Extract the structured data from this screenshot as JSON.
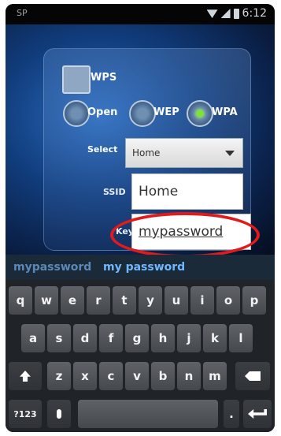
{
  "statusbar": {
    "left_label": "SP",
    "time": "6:12"
  },
  "form": {
    "wps_label": "WPS",
    "security": {
      "open_label": "Open",
      "wep_label": "WEP",
      "wpa_label": "WPA",
      "selected": "WPA"
    },
    "select_label": "Select",
    "select_value": "Home",
    "ssid_label": "SSID",
    "ssid_value": "Home",
    "password_label": "Key",
    "password_value": "mypassword"
  },
  "keyboard": {
    "suggestions": [
      "mypassword",
      "my password"
    ],
    "rows": [
      [
        "q",
        "w",
        "e",
        "r",
        "t",
        "y",
        "u",
        "i",
        "o",
        "p"
      ],
      [
        "a",
        "s",
        "d",
        "f",
        "g",
        "h",
        "j",
        "k",
        "l"
      ],
      [
        "z",
        "x",
        "c",
        "v",
        "b",
        "n",
        "m"
      ]
    ],
    "symbols_label": "?123",
    "period_label": "."
  },
  "colors": {
    "highlight": "#e11b1b",
    "radio_selected": "#7ee13a",
    "suggestion_primary": "#6fb7ff"
  }
}
